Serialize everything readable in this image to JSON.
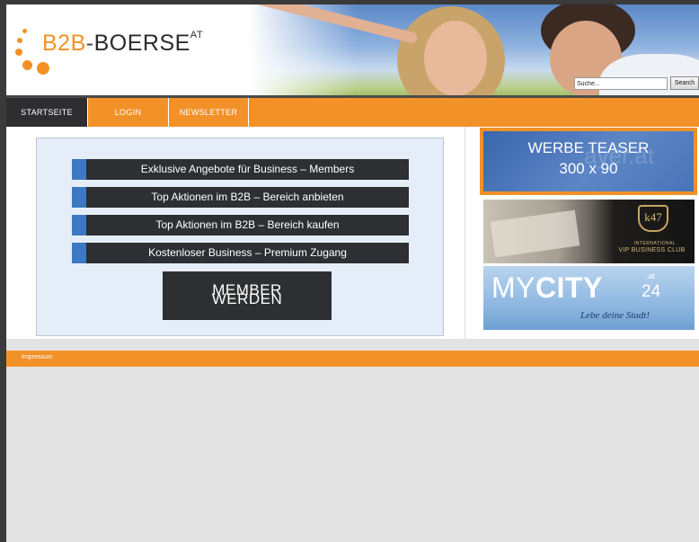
{
  "header": {
    "logo": {
      "b2b": "B2B",
      "dash": "-",
      "boerse": "BOERSE",
      "suffix": "AT"
    },
    "search": {
      "placeholder": "Suche...",
      "value": "Suche...",
      "button_label": "Search"
    }
  },
  "nav": {
    "items": [
      {
        "label": "STARTSEITE",
        "active": true
      },
      {
        "label": "LOGIN",
        "active": false
      },
      {
        "label": "NEWSLETTER",
        "active": false
      }
    ]
  },
  "promo": {
    "bars": [
      "Exklusive Angebote für Business – Members",
      "Top Aktionen im B2B – Bereich anbieten",
      "Top Aktionen im B2B – Bereich kaufen",
      "Kostenloser Business – Premium Zugang"
    ],
    "member_button": {
      "line1": "MEMBER",
      "line2": "WERDEN"
    }
  },
  "ads": {
    "werbe_teaser": {
      "line1": "WERBE TEASER",
      "line2": "300 x 90",
      "watermark": "ayer.at"
    },
    "k47": {
      "emblem": "k47",
      "line1": "INTERNATIONAL",
      "line2": "VIP BUSINESS CLUB"
    },
    "mycity": {
      "my": "MY",
      "city": "CITY",
      "at": ".at",
      "num": "24",
      "slogan": "Lebe deine Stadt!"
    }
  },
  "footer": {
    "impressum": "Impressum"
  },
  "colors": {
    "accent": "#f39129",
    "dark": "#2e2f32",
    "bar_accent": "#3d78c2",
    "promo_bg": "#e5eef8"
  }
}
